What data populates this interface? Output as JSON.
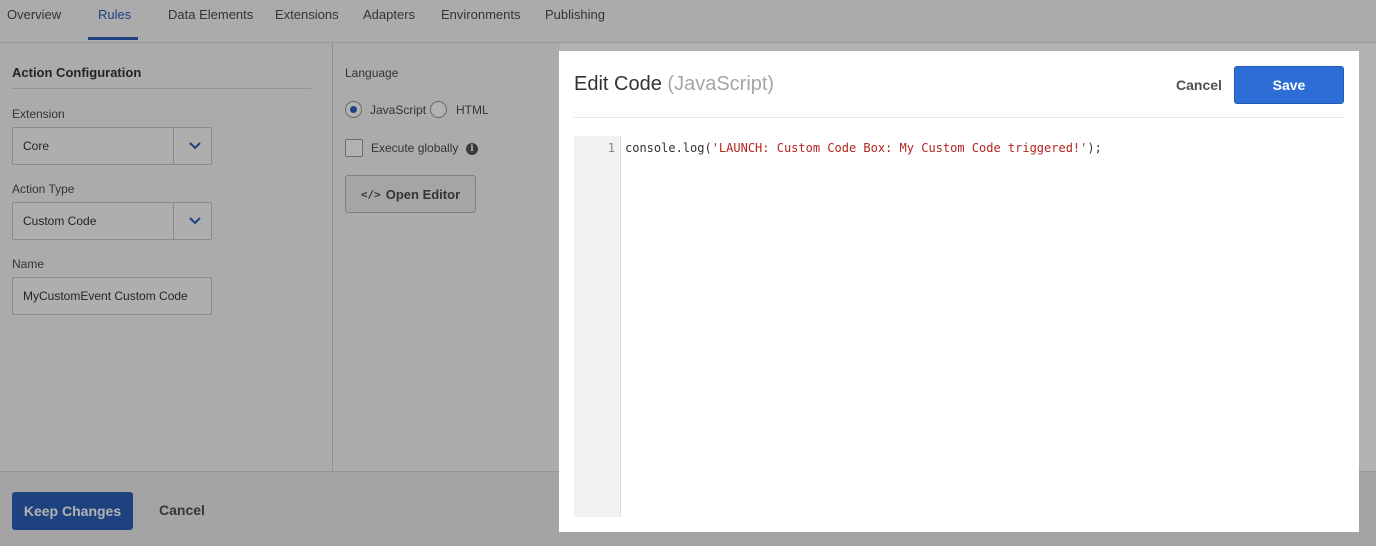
{
  "nav": {
    "tabs": [
      "Overview",
      "Rules",
      "Data Elements",
      "Extensions",
      "Adapters",
      "Environments",
      "Publishing"
    ],
    "active_tab": "Rules"
  },
  "left_panel": {
    "title": "Action Configuration",
    "extension_label": "Extension",
    "extension_value": "Core",
    "action_type_label": "Action Type",
    "action_type_value": "Custom Code",
    "name_label": "Name",
    "name_value": "MyCustomEvent Custom Code"
  },
  "middle_panel": {
    "language_label": "Language",
    "radio_javascript": "JavaScript",
    "radio_html": "HTML",
    "selected_language": "JavaScript",
    "execute_globally_label": "Execute globally",
    "execute_globally_checked": false,
    "info_icon_glyph": "i",
    "open_editor_icon_glyph": "</>",
    "open_editor_label": "Open Editor"
  },
  "bottom_bar": {
    "keep_changes_label": "Keep Changes",
    "cancel_label": "Cancel"
  },
  "modal": {
    "title": "Edit Code",
    "title_language": "(JavaScript)",
    "cancel_label": "Cancel",
    "save_label": "Save",
    "code": {
      "line_number": "1",
      "prefix": "console.log(",
      "string": "'LAUNCH: Custom Code Box: My Custom Code triggered!'",
      "suffix": ");"
    }
  },
  "colors": {
    "accent": "#2c5fb8",
    "save_button": "#2c6ed5",
    "code_string": "#b3261e"
  }
}
